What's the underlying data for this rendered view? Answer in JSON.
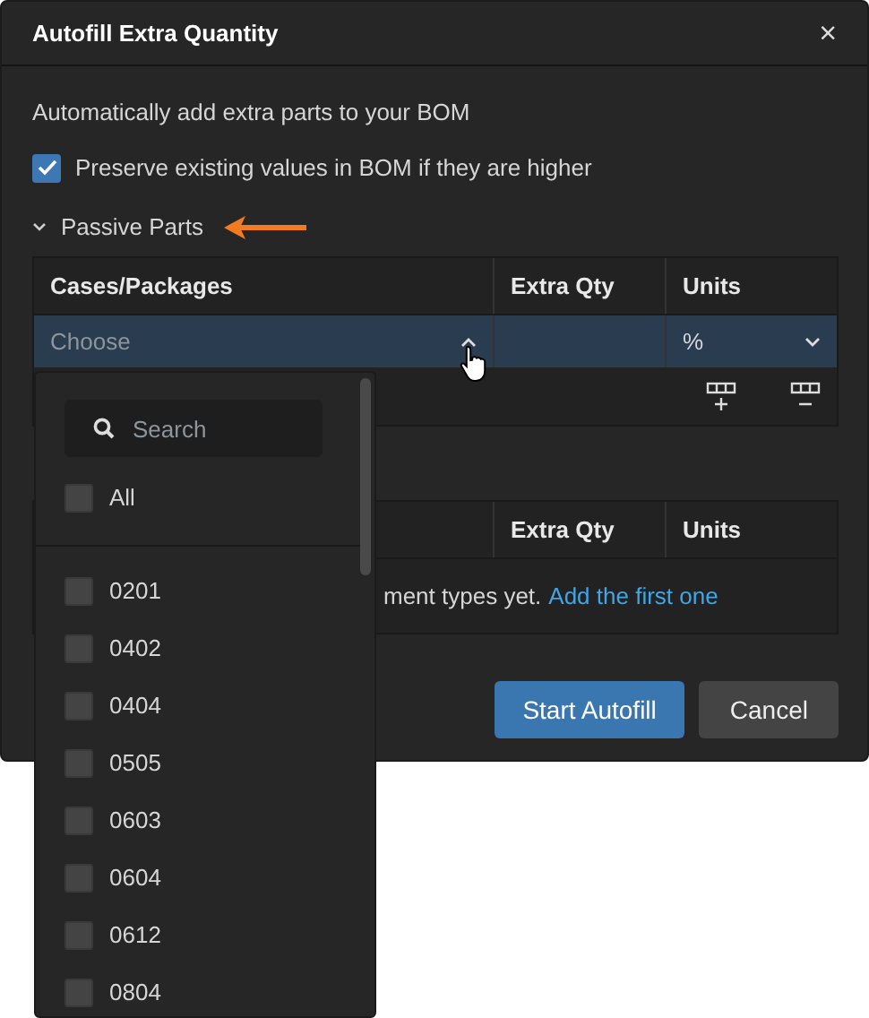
{
  "dialog": {
    "title": "Autofill Extra Quantity",
    "close": "×"
  },
  "description": "Automatically add extra parts to your BOM",
  "preserve": {
    "label": "Preserve existing values in BOM if they are higher",
    "checked": true
  },
  "section": {
    "title": "Passive Parts",
    "expanded": true,
    "columns": [
      "Cases/Packages",
      "Extra Qty",
      "Units"
    ],
    "rows": [
      {
        "package": {
          "placeholder": "Choose",
          "open": true
        },
        "units": "%",
        "selected": true
      }
    ]
  },
  "section_2": {
    "columns": [
      "Extra Qty",
      "Units"
    ],
    "empty_message": "ment types yet.",
    "link": "Add the first one"
  },
  "buttons": [
    {
      "label": "Start Autofill",
      "kind": "primary"
    },
    {
      "label": "Cancel",
      "kind": "secondary"
    }
  ],
  "dropdown": {
    "search_placeholder": "Search",
    "all": {
      "label": "All",
      "checked": false
    },
    "options": [
      {
        "label": "0201",
        "checked": false
      },
      {
        "label": "0402",
        "checked": false
      },
      {
        "label": "0404",
        "checked": false
      },
      {
        "label": "0505",
        "checked": false
      },
      {
        "label": "0603",
        "checked": false
      },
      {
        "label": "0604",
        "checked": false
      },
      {
        "label": "0612",
        "checked": false
      },
      {
        "label": "0804",
        "checked": false
      }
    ]
  }
}
